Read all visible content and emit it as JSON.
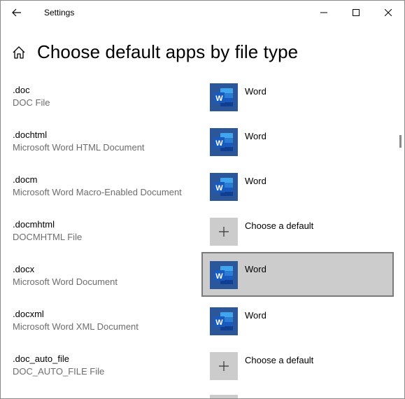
{
  "window": {
    "title": "Settings"
  },
  "page": {
    "title": "Choose default apps by file type"
  },
  "colors": {
    "word_blue": "#2b579a",
    "word_light": "#41a5ee",
    "selected_bg": "#cccccc"
  },
  "rows": [
    {
      "ext": ".doc",
      "desc": "DOC File",
      "app": "Word",
      "icon": "word-icon"
    },
    {
      "ext": ".dochtml",
      "desc": "Microsoft Word HTML Document",
      "app": "Word",
      "icon": "word-icon"
    },
    {
      "ext": ".docm",
      "desc": "Microsoft Word Macro-Enabled Document",
      "app": "Word",
      "icon": "word-icon"
    },
    {
      "ext": ".docmhtml",
      "desc": "DOCMHTML File",
      "app": "Choose a default",
      "icon": "plus-icon"
    },
    {
      "ext": ".docx",
      "desc": "Microsoft Word Document",
      "app": "Word",
      "icon": "word-icon"
    },
    {
      "ext": ".docxml",
      "desc": "Microsoft Word XML Document",
      "app": "Word",
      "icon": "word-icon"
    },
    {
      "ext": ".doc_auto_file",
      "desc": "DOC_AUTO_FILE File",
      "app": "Choose a default",
      "icon": "plus-icon"
    }
  ]
}
